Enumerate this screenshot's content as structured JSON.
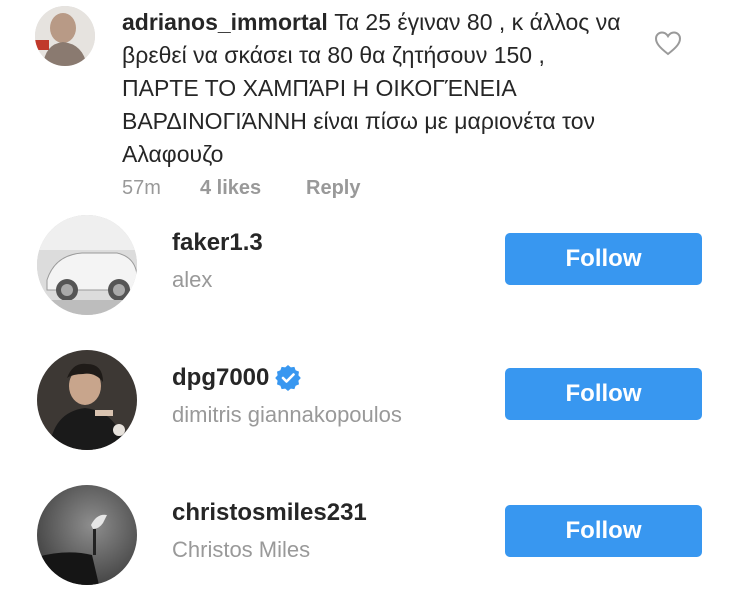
{
  "comment": {
    "username": "adrianos_immortal",
    "text": "Τα 25 έγιναν 80 , κ άλλος να βρεθεί να σκάσει τα 80 θα ζητήσουν 150 , ΠΑΡΤΕ ΤΟ ΧΑΜΠΆΡΙ Η ΟΙΚΟΓΈΝΕΙΑ ΒΑΡΔΙΝΟΓΙΆΝΝΗ είναι πίσω με μαριονέτα τον Αλαφουζο",
    "time": "57m",
    "likes": "4 likes",
    "reply_label": "Reply",
    "like_icon": "heart-outline-icon"
  },
  "suggestions": [
    {
      "username": "faker1.3",
      "full_name": "alex",
      "verified": false,
      "button_label": "Follow"
    },
    {
      "username": "dpg7000",
      "full_name": "dimitris giannakopoulos",
      "verified": true,
      "button_label": "Follow"
    },
    {
      "username": "christosmiles231",
      "full_name": "Christos Miles",
      "verified": false,
      "button_label": "Follow"
    }
  ],
  "colors": {
    "follow_button": "#3897f0",
    "secondary_text": "#999999",
    "primary_text": "#262626",
    "verified_badge": "#3897f0"
  }
}
